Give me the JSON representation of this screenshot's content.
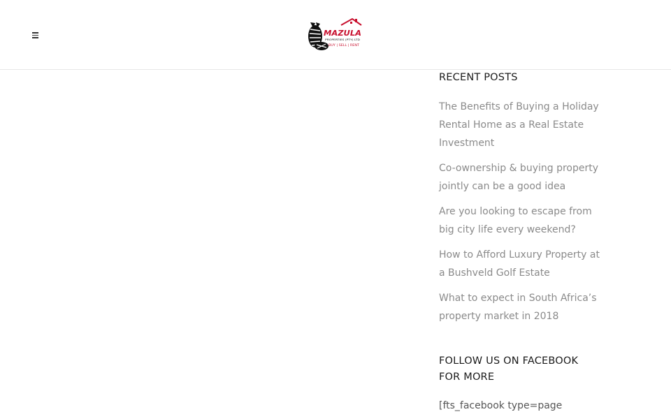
{
  "header": {
    "menu_icon": "hamburger-menu-icon",
    "logo": {
      "brand": "MAZULA",
      "subtitle": "PROPERTIES (PTY) LTD",
      "tagline": "BUY | SELL | RENT",
      "colors": {
        "red": "#c8102e",
        "black": "#111111"
      }
    }
  },
  "sidebar": {
    "recent_posts_title": "RECENT POSTS",
    "posts": [
      {
        "title": "The Benefits of Buying a Holiday Rental Home as a Real Estate Investment"
      },
      {
        "title": "Co-ownership & buying property jointly can be a good idea"
      },
      {
        "title": "Are you looking to escape from big city life every weekend?"
      },
      {
        "title": "How to Afford Luxury Property at a Bushveld Golf Estate"
      },
      {
        "title": "What to expect in South Africa’s property market in 2018"
      }
    ],
    "facebook_title": "FOLLOW US ON FACEBOOK FOR MORE",
    "facebook_shortcode": "[fts_facebook type=page"
  },
  "colors": {
    "link": "#8a8a8a",
    "heading": "#1a1a1a",
    "divider": "#e6e6e6"
  }
}
